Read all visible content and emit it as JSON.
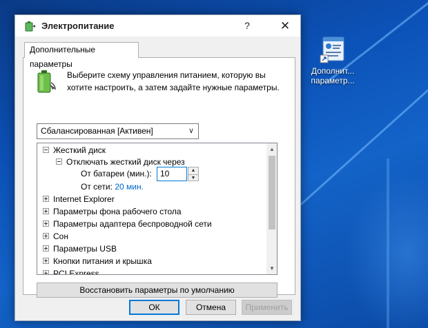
{
  "window": {
    "title": "Электропитание",
    "help_glyph": "?",
    "close_glyph": "✕"
  },
  "tab": {
    "label": "Дополнительные параметры"
  },
  "intro": {
    "text": "Выберите схему управления питанием, которую вы хотите настроить, а затем задайте нужные параметры."
  },
  "scheme": {
    "selected": "Сбалансированная [Активен]"
  },
  "tree": {
    "hard_disk": "Жесткий диск",
    "turn_off_disk": "Отключать жесткий диск через",
    "on_battery_label": "От батареи (мин.):",
    "on_battery_value": "10",
    "plugged_in_label": "От сети:",
    "plugged_in_value": "20 мин.",
    "items": [
      "Internet Explorer",
      "Параметры фона рабочего стола",
      "Параметры адаптера беспроводной сети",
      "Сон",
      "Параметры USB",
      "Кнопки питания и крышка",
      "PCI Express"
    ]
  },
  "buttons": {
    "restore": "Восстановить параметры по умолчанию",
    "ok": "ОК",
    "cancel": "Отмена",
    "apply": "Применить"
  },
  "desktop_icon": {
    "label_line1": "Дополнит...",
    "label_line2": "параметр..."
  },
  "colors": {
    "accent": "#0078d7",
    "link": "#0066cc",
    "desktop": "#0c52b8"
  }
}
